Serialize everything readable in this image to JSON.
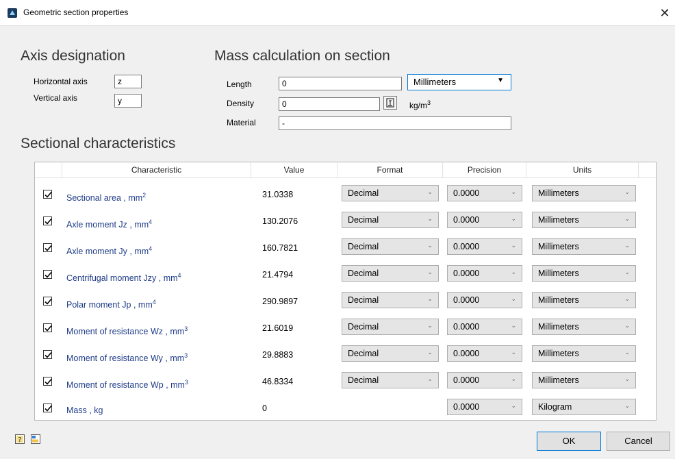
{
  "window": {
    "title": "Geometric section properties"
  },
  "axis": {
    "heading": "Axis designation",
    "horizontal_label": "Horizontal axis",
    "horizontal_value": "z",
    "vertical_label": "Vertical axis",
    "vertical_value": "y"
  },
  "mass": {
    "heading": "Mass calculation on section",
    "length_label": "Length",
    "length_value": "0",
    "length_unit": "Millimeters",
    "density_label": "Density",
    "density_value": "0",
    "density_unit": "kg/m",
    "density_unit_exp": "3",
    "material_label": "Material",
    "material_value": "-"
  },
  "sectional": {
    "heading": "Sectional characteristics",
    "columns": [
      "Characteristic",
      "Value",
      "Format",
      "Precision",
      "Units"
    ],
    "rows": [
      {
        "name": "Sectional area ,  mm",
        "exp": "2",
        "value": "31.0338",
        "format": "Decimal",
        "precision": "0.0000",
        "units": "Millimeters"
      },
      {
        "name": "Axle moment Jz ,  mm",
        "exp": "4",
        "value": "130.2076",
        "format": "Decimal",
        "precision": "0.0000",
        "units": "Millimeters"
      },
      {
        "name": "Axle moment Jy ,  mm",
        "exp": "4",
        "value": "160.7821",
        "format": "Decimal",
        "precision": "0.0000",
        "units": "Millimeters"
      },
      {
        "name": "Centrifugal moment Jzy ,  mm",
        "exp": "4",
        "value": "21.4794",
        "format": "Decimal",
        "precision": "0.0000",
        "units": "Millimeters"
      },
      {
        "name": "Polar moment Jp ,  mm",
        "exp": "4",
        "value": "290.9897",
        "format": "Decimal",
        "precision": "0.0000",
        "units": "Millimeters"
      },
      {
        "name": "Moment of resistance Wz ,  mm",
        "exp": "3",
        "value": "21.6019",
        "format": "Decimal",
        "precision": "0.0000",
        "units": "Millimeters"
      },
      {
        "name": "Moment of resistance Wy ,  mm",
        "exp": "3",
        "value": "29.8883",
        "format": "Decimal",
        "precision": "0.0000",
        "units": "Millimeters"
      },
      {
        "name": "Moment of resistance Wp ,  mm",
        "exp": "3",
        "value": "46.8334",
        "format": "Decimal",
        "precision": "0.0000",
        "units": "Millimeters"
      },
      {
        "name": "Mass ,  kg",
        "exp": "",
        "value": "0",
        "format": "",
        "precision": "0.0000",
        "units": "Kilogram"
      }
    ]
  },
  "buttons": {
    "ok": "OK",
    "cancel": "Cancel"
  },
  "icons": {
    "help": "help-icon",
    "export": "export-icon",
    "material": "material-library-icon",
    "app": "app-icon"
  },
  "colors": {
    "accent": "#0078d7",
    "link_text": "#1f3c88"
  }
}
